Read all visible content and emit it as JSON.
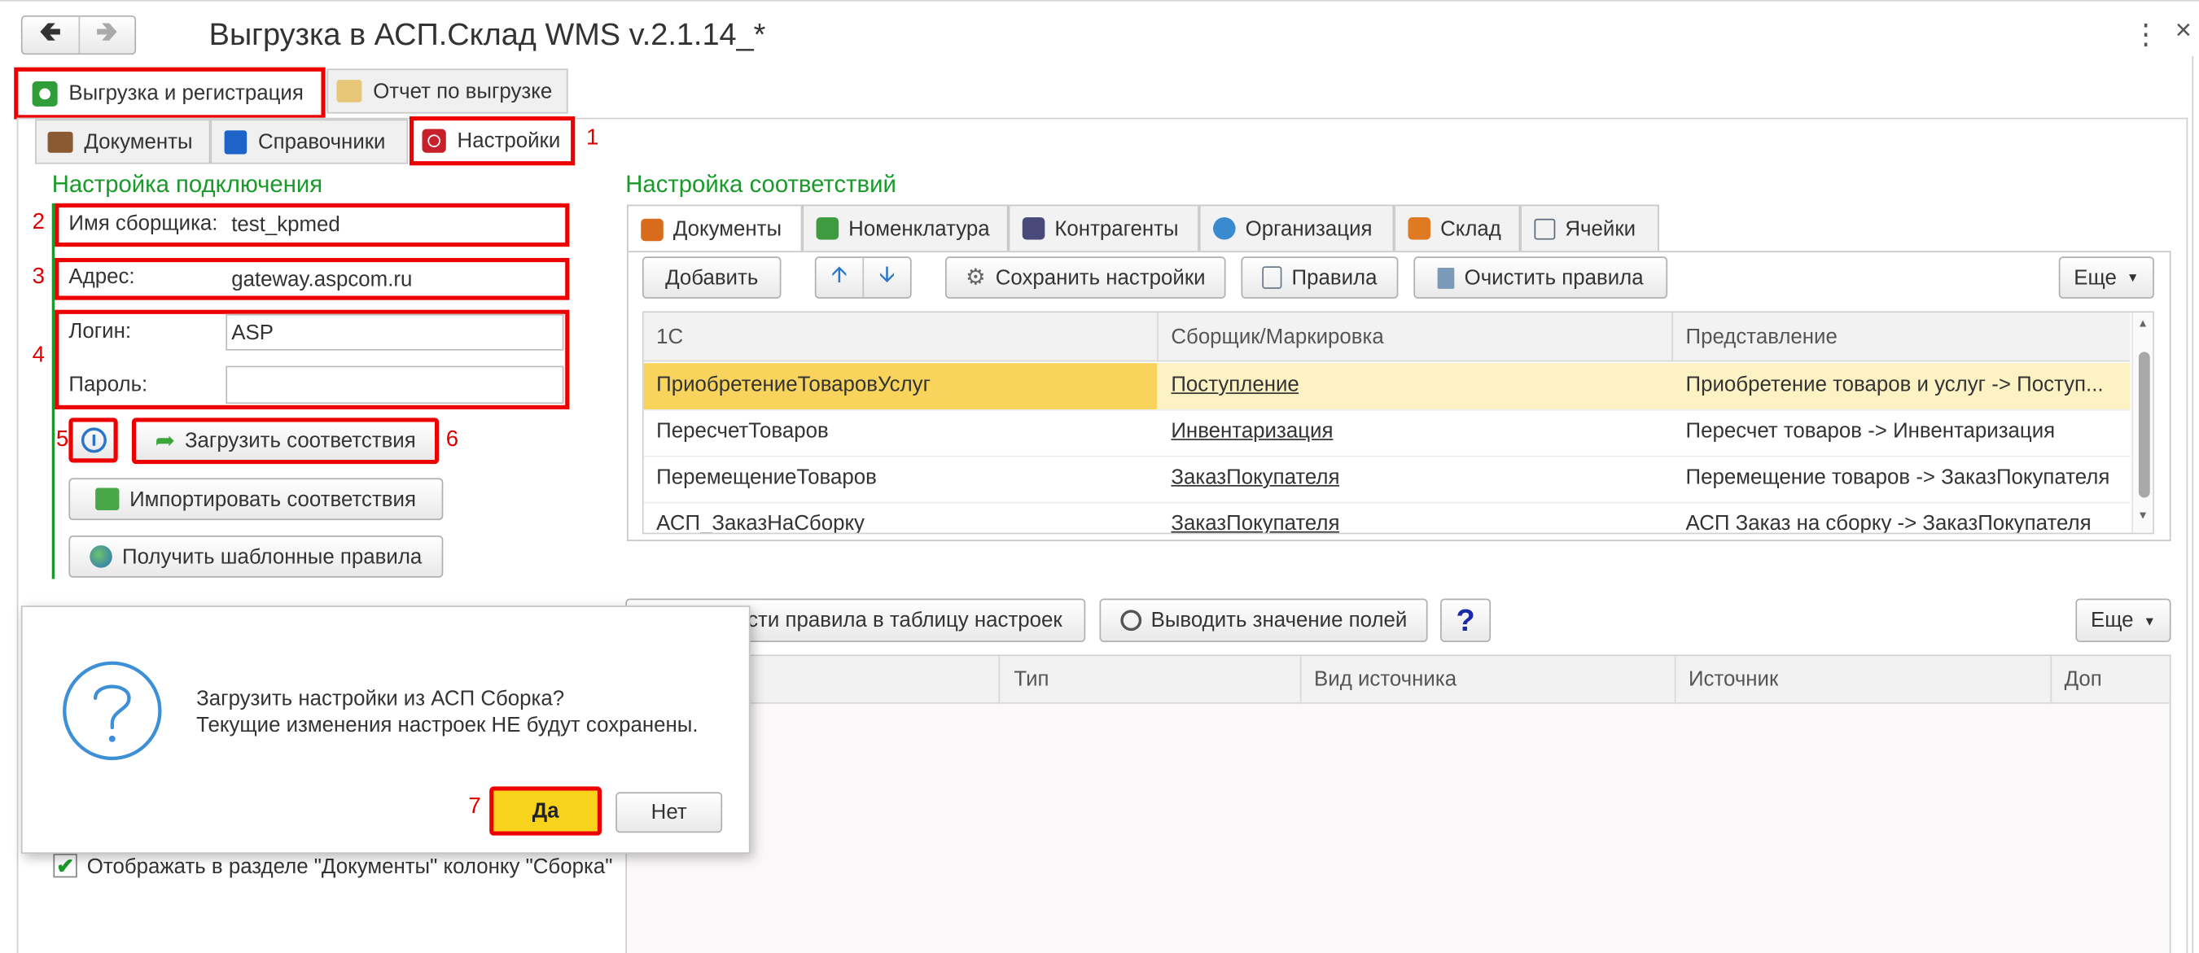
{
  "window": {
    "title": "Выгрузка в АСП.Склад WMS v.2.1.14_*",
    "more_icon": "⋮",
    "close_icon": "×"
  },
  "main_tabs": [
    {
      "label": "Выгрузка и регистрация"
    },
    {
      "label": "Отчет по выгрузке"
    }
  ],
  "sub_tabs": [
    {
      "label": "Документы"
    },
    {
      "label": "Справочники"
    },
    {
      "label": "Настройки"
    }
  ],
  "markers": {
    "m1": "1",
    "m2": "2",
    "m3": "3",
    "m4": "4",
    "m5": "5",
    "m6": "6",
    "m7": "7"
  },
  "connection": {
    "heading": "Настройка подключения",
    "collector_label": "Имя сборщика:",
    "collector_value": "test_kpmed",
    "address_label": "Адрес:",
    "address_value": "gateway.aspcom.ru",
    "login_label": "Логин:",
    "login_value": "ASP",
    "password_label": "Пароль:",
    "password_value": "",
    "load_mappings_label": "Загрузить соответствия",
    "import_mappings_label": "Импортировать соответствия",
    "template_rules_label": "Получить шаблонные правила",
    "show_column_label": "Отображать в разделе \"Документы\" колонку \"Сборка\""
  },
  "mapping": {
    "heading": "Настройка соответствий",
    "tabs": [
      {
        "label": "Документы"
      },
      {
        "label": "Номенклатура"
      },
      {
        "label": "Контрагенты"
      },
      {
        "label": "Организация"
      },
      {
        "label": "Склад"
      },
      {
        "label": "Ячейки"
      }
    ],
    "toolbar": {
      "add": "Добавить",
      "save_settings": "Сохранить настройки",
      "rules": "Правила",
      "clear_rules": "Очистить правила",
      "more": "Еще"
    },
    "columns": [
      "1С",
      "Сборщик/Маркировка",
      "Представление"
    ],
    "rows": [
      [
        "ПриобретениеТоваровУслуг",
        "Поступление",
        "Приобретение товаров и услуг -> Поступ..."
      ],
      [
        "ПересчетТоваров",
        "Инвентаризация",
        "Пересчет товаров -> Инвентаризация"
      ],
      [
        "ПеремещениеТоваров",
        "ЗаказПокупателя",
        "Перемещение товаров -> ЗаказПокупателя"
      ],
      [
        "АСП_ЗаказНаСборку",
        "ЗаказПокупателя",
        "АСП Заказ на сборку -> ЗаказПокупателя"
      ]
    ]
  },
  "rules": {
    "toolbar": {
      "copy_rules_visible": "сти правила в таблицу настроек",
      "show_fields": "Выводить значение полей",
      "help": "?",
      "more": "Еще"
    },
    "columns": [
      "Тип",
      "Вид источника",
      "Источник",
      "Доп"
    ]
  },
  "dialog": {
    "line1": "Загрузить настройки из АСП Сборка?",
    "line2": "Текущие изменения настроек НЕ будут сохранены.",
    "yes": "Да",
    "no": "Нет"
  },
  "colors": {
    "accent_green": "#1a9a2a",
    "highlight_red": "#ec0000",
    "selected_row": "#fdf2c4",
    "yes_button": "#f7d31c"
  }
}
